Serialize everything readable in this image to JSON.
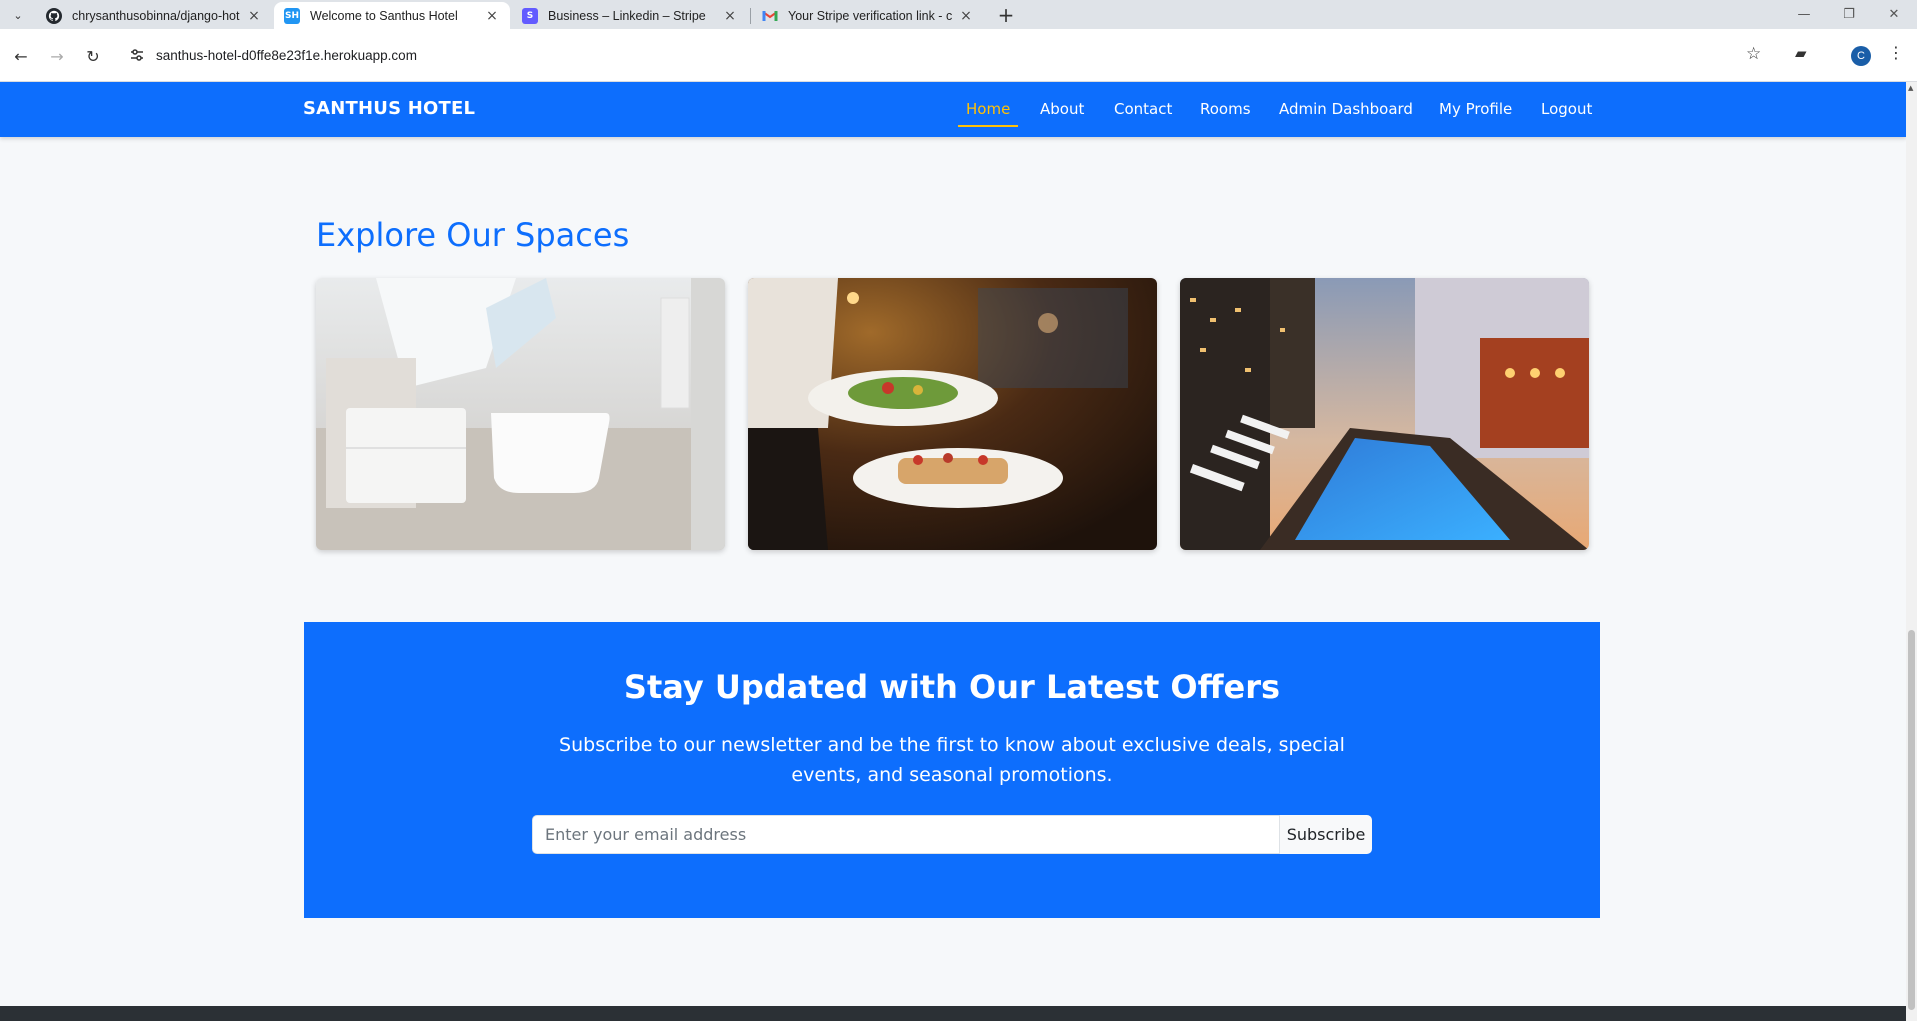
{
  "browser": {
    "tabs": [
      {
        "title": "chrysanthusobinna/django-hot",
        "favicon": "github-icon",
        "active": false
      },
      {
        "title": "Welcome to Santhus Hotel",
        "favicon": "SH",
        "active": true
      },
      {
        "title": "Business – Linkedin – Stripe",
        "favicon": "S",
        "active": false
      },
      {
        "title": "Your Stripe verification link - ch",
        "favicon": "gmail-icon",
        "active": false
      }
    ],
    "url": "santhus-hotel-d0ffe8e23f1e.herokuapp.com",
    "profile_initial": "C"
  },
  "site": {
    "brand": "SANTHUS HOTEL",
    "nav": [
      {
        "label": "Home",
        "active": true
      },
      {
        "label": "About",
        "active": false
      },
      {
        "label": "Contact",
        "active": false
      },
      {
        "label": "Rooms",
        "active": false
      },
      {
        "label": "Admin Dashboard",
        "active": false
      },
      {
        "label": "My Profile",
        "active": false
      },
      {
        "label": "Logout",
        "active": false
      }
    ],
    "primary_color": "#0d6efd",
    "accent_color": "#ffc107"
  },
  "spaces": {
    "heading": "Explore Our Spaces",
    "photos": [
      "bathroom-photo",
      "restaurant-dish-photo",
      "rooftop-pool-photo"
    ]
  },
  "newsletter": {
    "title": "Stay Updated with Our Latest Offers",
    "text": "Subscribe to our newsletter and be the first to know about exclusive deals, special events, and seasonal promotions.",
    "email_placeholder": "Enter your email address",
    "subscribe_label": "Subscribe"
  }
}
